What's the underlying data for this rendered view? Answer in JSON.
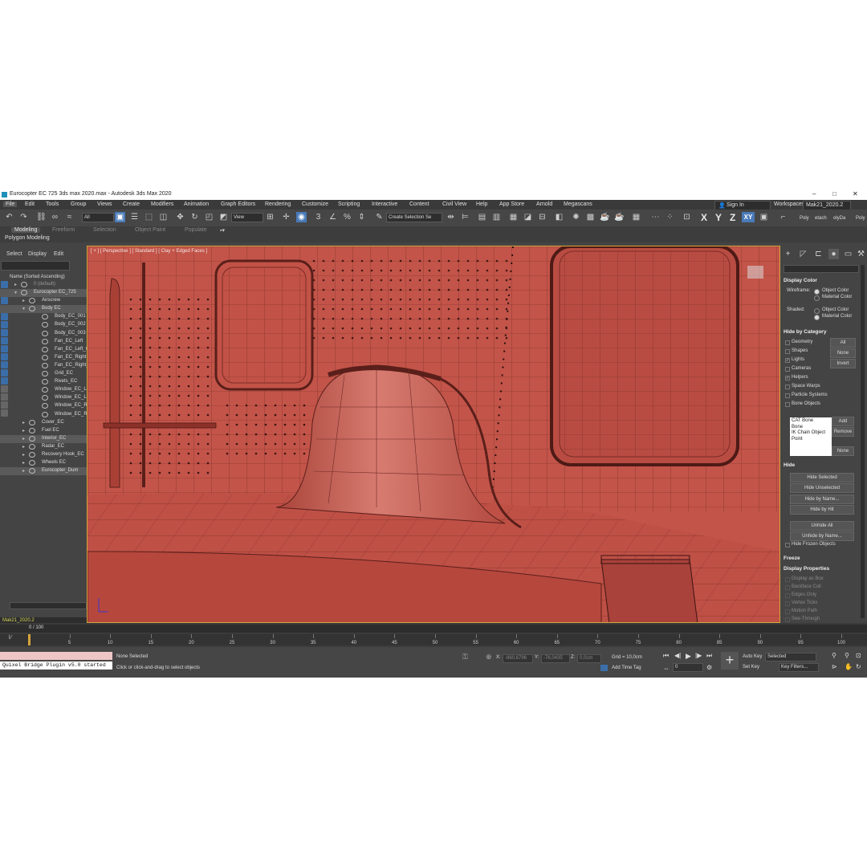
{
  "window": {
    "title": "Eurocopter EC 725 3ds max 2020.max - Autodesk 3ds Max 2020",
    "controls": [
      "–",
      "□",
      "✕"
    ]
  },
  "menu": {
    "items": [
      "File",
      "Edit",
      "Tools",
      "Group",
      "Views",
      "Create",
      "Modifiers",
      "Animation",
      "Graph Editors",
      "Rendering",
      "Customize",
      "Scripting",
      "Interactive",
      "Content",
      "Civil View",
      "Help",
      "App Store",
      "Arnold",
      "Megascans"
    ],
    "sign_in": "Sign In",
    "workspaces_label": "Workspaces:",
    "workspace_value": "Mak21_2020.2"
  },
  "toolbar": {
    "filter_value": "All",
    "view_value": "View",
    "selection_set_placeholder": "Create Selection Se",
    "axis_x": "X",
    "axis_y": "Y",
    "axis_z": "Z",
    "axis_xy": "XY",
    "poly_labels": [
      "Poly",
      "etach",
      "olyDa",
      "Poly"
    ]
  },
  "ribbon": {
    "tabs": [
      "Modeling",
      "Freeform",
      "Selection",
      "Object Paint",
      "Populate"
    ],
    "sub_label": "Polygon Modeling"
  },
  "scene_explorer": {
    "menus": [
      "Select",
      "Display",
      "Edit"
    ],
    "column_header": "Name (Sorted Ascending)",
    "items": [
      {
        "label": "0 (default)",
        "level": 1,
        "dim": true
      },
      {
        "label": "Eurocopter EC_725",
        "level": 1,
        "selected": true
      },
      {
        "label": "Airscrew",
        "level": 2
      },
      {
        "label": "Body EC",
        "level": 2,
        "selected": true
      },
      {
        "label": "Body_EC_001",
        "level": 3
      },
      {
        "label": "Body_EC_002",
        "level": 3
      },
      {
        "label": "Body_EC_003",
        "level": 3
      },
      {
        "label": "Fan_EC_Left",
        "level": 3
      },
      {
        "label": "Fan_EC_Left_C",
        "level": 3
      },
      {
        "label": "Fan_EC_Right",
        "level": 3
      },
      {
        "label": "Fan_EC_Right_(",
        "level": 3
      },
      {
        "label": "Grid_EC",
        "level": 3
      },
      {
        "label": "Rivets_EC",
        "level": 3
      },
      {
        "label": "Window_EC_Le",
        "level": 3
      },
      {
        "label": "Window_EC_Le",
        "level": 3
      },
      {
        "label": "Window_EC_Rig",
        "level": 3
      },
      {
        "label": "Window_EC_Rig",
        "level": 3
      },
      {
        "label": "Cover_EC",
        "level": 2
      },
      {
        "label": "Fuel EC",
        "level": 2
      },
      {
        "label": "Interior_EC",
        "level": 2,
        "selected": true
      },
      {
        "label": "Radar_EC",
        "level": 2
      },
      {
        "label": "Recovery Hook_EC",
        "level": 2
      },
      {
        "label": "Wheels EC",
        "level": 2
      },
      {
        "label": "Eurocopter_Dum",
        "level": 2,
        "selected": true
      }
    ],
    "layer_bar": "Mak21_2020.2"
  },
  "viewport": {
    "label": "[ + ] [ Perspective ] [ Standard ] [ Clay + Edged Faces ]"
  },
  "command_panel": {
    "display_color_title": "Display Color",
    "wireframe_label": "Wireframe:",
    "shaded_label": "Shaded:",
    "object_color": "Object Color",
    "material_color": "Material Color",
    "hide_by_category_title": "Hide by Category",
    "categories": [
      {
        "label": "Geometry",
        "checked": false
      },
      {
        "label": "Shapes",
        "checked": false
      },
      {
        "label": "Lights",
        "checked": true
      },
      {
        "label": "Cameras",
        "checked": false
      },
      {
        "label": "Helpers",
        "checked": true
      },
      {
        "label": "Space Warps",
        "checked": false
      },
      {
        "label": "Particle Systems",
        "checked": false
      },
      {
        "label": "Bone Objects",
        "checked": false
      }
    ],
    "btn_all": "All",
    "btn_none": "None",
    "btn_invert": "Invert",
    "category_list": [
      "CAT Bone",
      "Bone",
      "IK Chain Object",
      "Point"
    ],
    "btn_add": "Add",
    "btn_remove": "Remove",
    "btn_none2": "None",
    "hide_title": "Hide",
    "hide_buttons": [
      "Hide Selected",
      "Hide Unselected",
      "Hide by Name...",
      "Hide by Hit",
      "Unhide All",
      "Unhide by Name..."
    ],
    "hide_frozen": "Hide Frozen Objects",
    "freeze_title": "Freeze",
    "display_props_title": "Display Properties",
    "display_props": [
      "Display as Box",
      "Backface Cull",
      "Edges Only",
      "Vertex Ticks",
      "Motion Path",
      "See-Through"
    ]
  },
  "timeline": {
    "frame_value": "0 / 100",
    "ticks": [
      "5",
      "10",
      "15",
      "20",
      "25",
      "30",
      "35",
      "40",
      "45",
      "50",
      "55",
      "60",
      "65",
      "70",
      "75",
      "80",
      "85",
      "90",
      "95",
      "100"
    ]
  },
  "status": {
    "listener_text": "Quixel Bridge Plugin v5.0 started",
    "selection_status": "None Selected",
    "prompt": "Click or click-and-drag to select objects",
    "x_label": "X:",
    "x_value": "-860,8796",
    "y_label": "Y:",
    "y_value": "-76,0435",
    "z_label": "Z:",
    "z_value": "0,0cm",
    "grid": "Grid = 10,0cm",
    "add_time_tag": "Add Time Tag",
    "auto_key": "Auto Key",
    "set_key": "Set Key",
    "selected_value": "Selected",
    "key_filters": "Key Filters...",
    "frame_field": "0"
  },
  "colors": {
    "viewport_bg": "#c5574b",
    "ui_bg": "#444444",
    "accent": "#4a7ab8",
    "active_border": "#d6a53a"
  }
}
